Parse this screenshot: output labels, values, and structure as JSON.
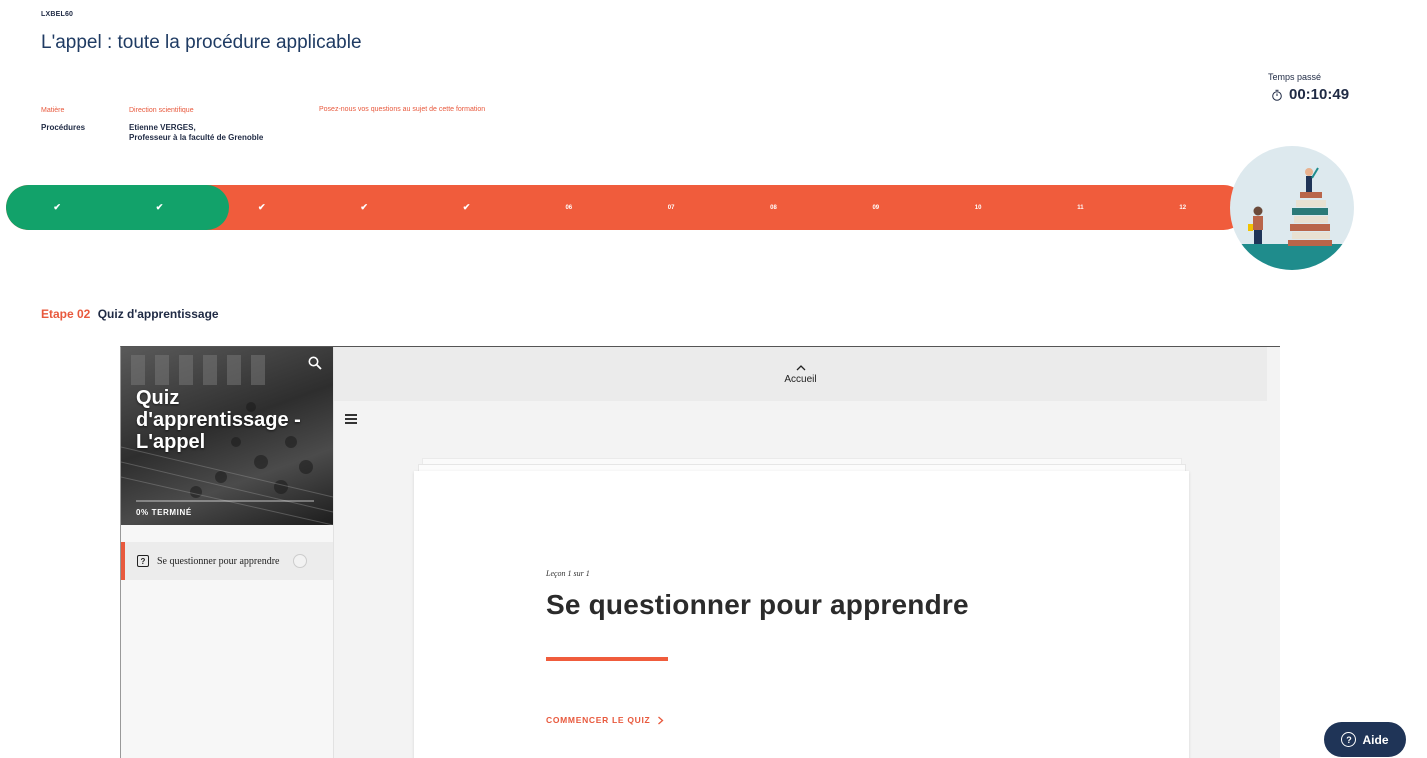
{
  "course": {
    "code": "LXBEL60",
    "title": "L'appel : toute la procédure applicable"
  },
  "meta": {
    "subject_label": "Matière",
    "subject_value": "Procédures",
    "direction_label": "Direction scientifique",
    "direction_name": "Etienne VERGES,",
    "direction_role": "Professeur à la faculté de Grenoble",
    "contact_link": "Posez-nous vos questions au sujet de cette formation"
  },
  "timer": {
    "label": "Temps passé",
    "value": "00:10:49"
  },
  "progress": {
    "completed_fraction": 0.18,
    "steps": [
      {
        "label": "✔",
        "status": "done"
      },
      {
        "label": "✔",
        "status": "done"
      },
      {
        "label": "✔",
        "status": "pending"
      },
      {
        "label": "✔",
        "status": "pending"
      },
      {
        "label": "✔",
        "status": "pending"
      },
      {
        "label": "06",
        "status": "pending"
      },
      {
        "label": "07",
        "status": "pending"
      },
      {
        "label": "08",
        "status": "pending"
      },
      {
        "label": "09",
        "status": "pending"
      },
      {
        "label": "10",
        "status": "pending"
      },
      {
        "label": "11",
        "status": "pending"
      },
      {
        "label": "12",
        "status": "pending"
      }
    ]
  },
  "etape": {
    "number": "Etape 02",
    "name": "Quiz d'apprentissage"
  },
  "quiz": {
    "hero_title": "Quiz d'apprentissage - L'appel",
    "hero_progress": "0% TERMINÉ",
    "lesson_item": "Se questionner pour apprendre",
    "topbar_label": "Accueil",
    "lesson_count": "Leçon 1 sur 1",
    "lesson_title": "Se questionner pour apprendre",
    "start_label": "COMMENCER LE QUIZ"
  },
  "help": {
    "label": "Aide"
  },
  "colors": {
    "accent": "#f05c3c",
    "done": "#12a26a",
    "navy": "#1f3457"
  },
  "icons": [
    "stopwatch-icon",
    "check-icon",
    "search-icon",
    "quiz-icon",
    "chevron-up-icon",
    "menu-icon",
    "chevron-right-icon",
    "help-icon"
  ]
}
